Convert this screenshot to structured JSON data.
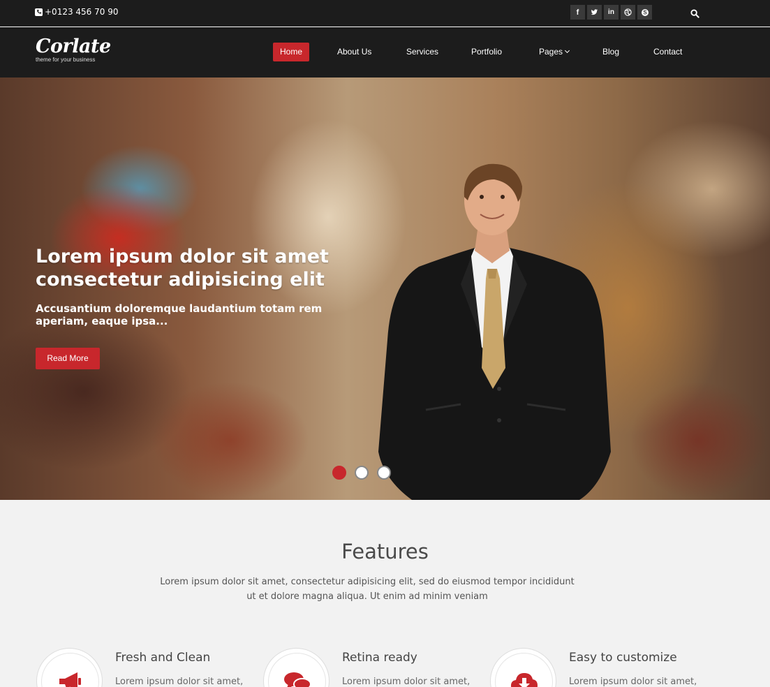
{
  "topbar": {
    "phone": "+0123 456 70 90",
    "socials": [
      {
        "icon": "facebook-icon",
        "glyph": "f"
      },
      {
        "icon": "twitter-icon",
        "glyph": "t"
      },
      {
        "icon": "linkedin-icon",
        "glyph": "in"
      },
      {
        "icon": "dribbble-icon",
        "glyph": "⊕"
      },
      {
        "icon": "skype-icon",
        "glyph": "S"
      }
    ]
  },
  "logo": {
    "name": "Corlate",
    "tagline": "theme for your business"
  },
  "nav": {
    "home": "Home",
    "about": "About Us",
    "services": "Services",
    "portfolio": "Portfolio",
    "pages": "Pages",
    "blog": "Blog",
    "contact": "Contact"
  },
  "hero": {
    "title": "Lorem ipsum dolor sit amet consectetur adipisicing elit",
    "subtitle": "Accusantium doloremque laudantium totam rem aperiam, eaque ipsa...",
    "button": "Read More",
    "active_slide": 1,
    "slide_count": 3
  },
  "features": {
    "title": "Features",
    "description": "Lorem ipsum dolor sit amet, consectetur adipisicing elit, sed do eiusmod tempor incididunt ut et dolore magna aliqua. Ut enim ad minim veniam",
    "items": [
      {
        "title": "Fresh and Clean",
        "text": "Lorem ipsum dolor sit amet,",
        "icon": "megaphone-icon"
      },
      {
        "title": "Retina ready",
        "text": "Lorem ipsum dolor sit amet,",
        "icon": "chat-icon"
      },
      {
        "title": "Easy to customize",
        "text": "Lorem ipsum dolor sit amet,",
        "icon": "cloud-download-icon"
      }
    ]
  },
  "colors": {
    "accent": "#c8272c",
    "header_bg": "#1c1c1c"
  }
}
